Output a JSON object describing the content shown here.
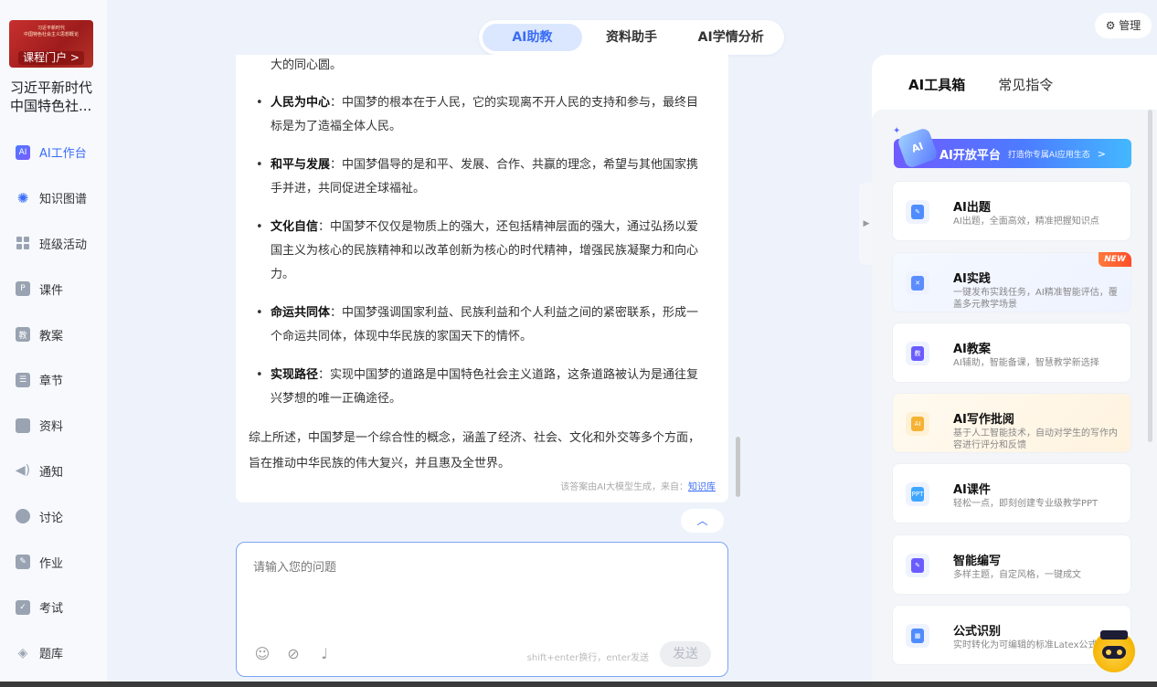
{
  "sidebar": {
    "cover_lines": [
      "习近平新时代",
      "中国特色社会主义思想概论"
    ],
    "portal_label": "课程门户 >",
    "course_title": "习近平新时代中国特色社...",
    "items": [
      {
        "label": "AI工作台",
        "icon": "ai-workbench-icon",
        "active": true
      },
      {
        "label": "知识图谱",
        "icon": "knowledge-graph-icon"
      },
      {
        "label": "班级活动",
        "icon": "class-activity-icon"
      },
      {
        "label": "课件",
        "icon": "courseware-icon"
      },
      {
        "label": "教案",
        "icon": "lesson-plan-icon"
      },
      {
        "label": "章节",
        "icon": "chapter-icon"
      },
      {
        "label": "资料",
        "icon": "folder-icon"
      },
      {
        "label": "通知",
        "icon": "speaker-icon"
      },
      {
        "label": "讨论",
        "icon": "discussion-icon"
      },
      {
        "label": "作业",
        "icon": "homework-icon"
      },
      {
        "label": "考试",
        "icon": "exam-icon"
      },
      {
        "label": "题库",
        "icon": "question-bank-icon"
      }
    ]
  },
  "top_tabs": [
    {
      "label": "AI助教",
      "active": true
    },
    {
      "label": "资料助手",
      "active": false
    },
    {
      "label": "AI学情分析",
      "active": false
    }
  ],
  "manage_label": "管理",
  "answer": {
    "first_line": "大的同心圆。",
    "bullets": [
      {
        "term": "人民为中心",
        "text": "：中国梦的根本在于人民，它的实现离不开人民的支持和参与，最终目标是为了造福全体人民。"
      },
      {
        "term": "和平与发展",
        "text": "：中国梦倡导的是和平、发展、合作、共赢的理念，希望与其他国家携手并进，共同促进全球福祉。"
      },
      {
        "term": "文化自信",
        "text": "：中国梦不仅仅是物质上的强大，还包括精神层面的强大，通过弘扬以爱国主义为核心的民族精神和以改革创新为核心的时代精神，增强民族凝聚力和向心力。"
      },
      {
        "term": "命运共同体",
        "text": "：中国梦强调国家利益、民族利益和个人利益之间的紧密联系，形成一个命运共同体，体现中华民族的家国天下的情怀。"
      },
      {
        "term": "实现路径",
        "text": "：实现中国梦的道路是中国特色社会主义道路，这条道路被认为是通往复兴梦想的唯一正确途径。"
      }
    ],
    "summary": "综上所述，中国梦是一个综合性的概念，涵盖了经济、社会、文化和外交等多个方面，旨在推动中华民族的伟大复兴，并且惠及全世界。",
    "source_prefix": "该答案由AI大模型生成，来自：",
    "source_link": "知识库"
  },
  "input": {
    "placeholder": "请输入您的问题",
    "hint": "shift+enter换行，enter发送",
    "send_label": "发送"
  },
  "right_panel": {
    "tabs": [
      {
        "label": "AI工具箱",
        "active": true
      },
      {
        "label": "常见指令",
        "active": false
      }
    ],
    "banner": {
      "title": "AI开放平台",
      "subtitle": "打造你专属AI应用生态",
      "arrow": ">"
    },
    "tools": [
      {
        "name": "AI出题",
        "desc": "AI出题，全面高效，精准把握知识点",
        "color": "#4e8cff"
      },
      {
        "name": "AI实践",
        "desc": "一键发布实践任务，AI精准智能评估，覆盖多元教学场景",
        "color": "#5b8dff",
        "badge": "NEW"
      },
      {
        "name": "AI教案",
        "desc": "AI辅助，智能备课，智慧教学新选择",
        "color": "#6a5cff"
      },
      {
        "name": "AI写作批阅",
        "desc": "基于人工智能技术，自动对学生的写作内容进行评分和反馈",
        "color": "#f5b233"
      },
      {
        "name": "AI课件",
        "desc": "轻松一点，即刻创建专业级教学PPT",
        "color": "#3fa6ff"
      },
      {
        "name": "智能编写",
        "desc": "多样主题，自定风格，一键成文",
        "color": "#6a5cff"
      },
      {
        "name": "公式识别",
        "desc": "实时转化为可编辑的标准Latex公式",
        "color": "#4e8cff"
      }
    ]
  }
}
